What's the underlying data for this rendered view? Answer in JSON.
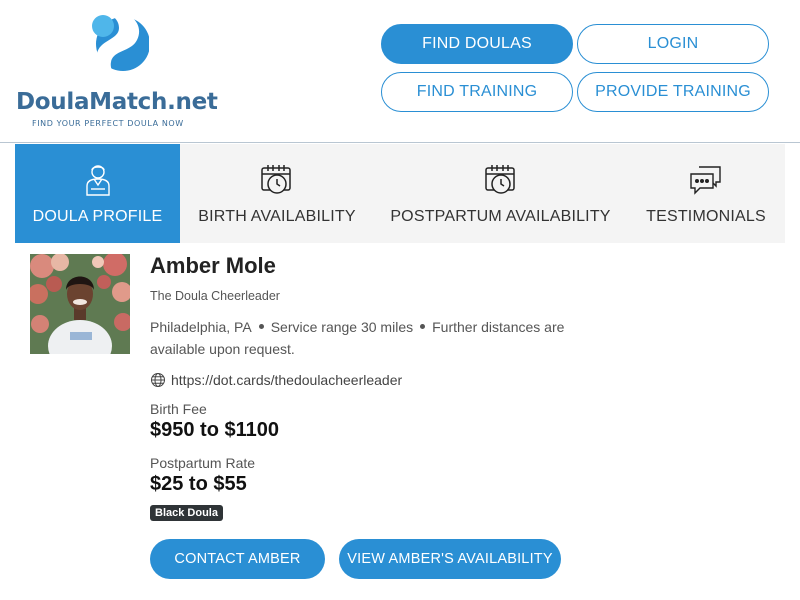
{
  "logo": {
    "brand_name": "DoulaMatch",
    "brand_tld": ".net",
    "tagline": "FIND YOUR PERFECT DOULA NOW",
    "colors": {
      "dark_blue": "#3a6c98",
      "light_blue": "#2a8fd4",
      "sky": "#4fb6ea"
    }
  },
  "nav": {
    "find_doulas": "FIND DOULAS",
    "login": "LOGIN",
    "find_training": "FIND TRAINING",
    "provide_training": "PROVIDE TRAINING"
  },
  "tabs": [
    {
      "label": "DOULA PROFILE",
      "icon": "doula-person-icon",
      "active": true
    },
    {
      "label": "BIRTH AVAILABILITY",
      "icon": "calendar-clock-icon",
      "active": false
    },
    {
      "label": "POSTPARTUM AVAILABILITY",
      "icon": "calendar-clock-icon",
      "active": false
    },
    {
      "label": "TESTIMONIALS",
      "icon": "chat-bubbles-icon",
      "active": false
    }
  ],
  "profile": {
    "name": "Amber Mole",
    "subtitle": "The Doula Cheerleader",
    "city": "Philadelphia, PA",
    "service_range": "Service range 30 miles",
    "distance_note": "Further distances are available upon request.",
    "website": "https://dot.cards/thedoulacheerleader",
    "birth_fee_label": "Birth Fee",
    "birth_fee": "$950 to $1100",
    "postpartum_label": "Postpartum Rate",
    "postpartum_rate": "$25 to $55",
    "badge": "Black Doula"
  },
  "actions": {
    "contact": "CONTACT AMBER",
    "availability": "VIEW AMBER'S AVAILABILITY"
  },
  "theme": {
    "accent": "#2a8fd4",
    "tab_bg": "#f4f4f4",
    "badge_bg": "#2f3437"
  }
}
